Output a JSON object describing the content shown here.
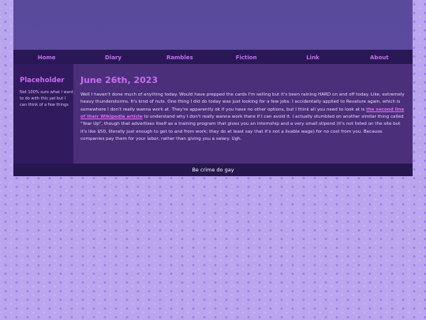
{
  "nav": {
    "items": [
      {
        "label": "Home"
      },
      {
        "label": "Diary"
      },
      {
        "label": "Rambles"
      },
      {
        "label": "Fiction"
      },
      {
        "label": "Link"
      },
      {
        "label": "About"
      }
    ]
  },
  "sidebar": {
    "title": "Placeholder",
    "text": "Not 100% sure what I want to do with this yet but I can think of a few things"
  },
  "post": {
    "date": "June 26th, 2023",
    "body_before": "Well I haven't done much of anything today. Would have prepped the cards I'm selling but it's been raining HARD on and off today. Like, extremely heavy thunderstorms. It's kind of nuts. One thing I did do today was just looking for a few jobs. I accidentally applied to Revature again, which is somewhere I don't really wanna work at. They're apparently ok if you have no other options, but I think all you need to look at is ",
    "link_text": "the second line of their Wikipedia article",
    "body_after": " to understand why I don't really wanna work there if I can avoid it. I actually stumbled on another similar thing called \"Year Up\", though that advertises itself as a training program that gives you an internship and a very small stipend (it's not listed on the site but it's like $50, literally just enough to get to and from work; they do at least say that it's not a livable wage) for no cost from you. Because companies pay them for your labor, rather than giving you a salary. Ugh."
  },
  "footer": {
    "text": "Be crime do gay"
  },
  "colors": {
    "accent": "#c86df2",
    "nav_bg": "#2a1856",
    "page_bg": "#b9a6ee"
  }
}
